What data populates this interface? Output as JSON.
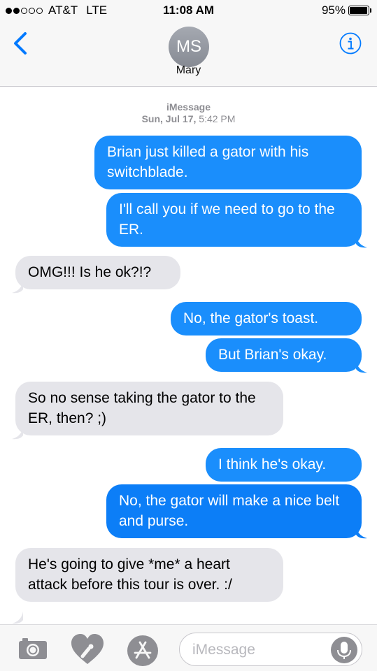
{
  "status_bar": {
    "signal_full": 2,
    "signal_empty": 3,
    "carrier": "AT&T",
    "network": "LTE",
    "time": "11:08 AM",
    "battery": "95%",
    "battery_level": 0.95
  },
  "header": {
    "back_icon": "chevron-left-icon",
    "avatar_initials": "MS",
    "contact_name": "Mary",
    "info_icon": "info-icon"
  },
  "conversation": {
    "service": "iMessage",
    "date": "Sun, Jul 17,",
    "time": "5:42 PM",
    "messages": [
      {
        "from": "me",
        "text": "Brian just killed a gator with his switchblade."
      },
      {
        "from": "me",
        "text": "I'll call you if we need to go to the ER."
      },
      {
        "from": "them",
        "text": "OMG!!! Is he ok?!?"
      },
      {
        "from": "me",
        "text": "No, the gator's toast."
      },
      {
        "from": "me",
        "text": "But Brian's okay."
      },
      {
        "from": "them",
        "text": "So no sense taking the gator to the ER, then? ;)"
      },
      {
        "from": "me",
        "text": "I think he's okay."
      },
      {
        "from": "me",
        "text": "No, the gator will make a nice belt and purse."
      },
      {
        "from": "them",
        "text": "He's going to give *me* a heart attack before this tour is over. :/"
      }
    ]
  },
  "input_bar": {
    "camera_icon": "camera-icon",
    "digital_touch_icon": "digital-touch-heart-icon",
    "app_store_icon": "app-store-icon",
    "placeholder": "iMessage",
    "mic_icon": "microphone-icon"
  },
  "colors": {
    "outgoing_bubble": "#1a8efc",
    "incoming_bubble": "#e5e5ea",
    "accent": "#007aff"
  }
}
